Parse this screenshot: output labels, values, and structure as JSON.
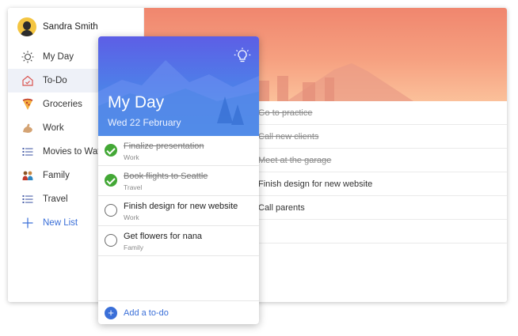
{
  "user": {
    "name": "Sandra Smith"
  },
  "sidebar": {
    "items": [
      {
        "label": "My Day",
        "icon": "sun-icon"
      },
      {
        "label": "To-Do",
        "icon": "home-icon"
      },
      {
        "label": "Groceries",
        "icon": "pizza-icon"
      },
      {
        "label": "Work",
        "icon": "flex-arm-icon"
      },
      {
        "label": "Movies to Watch",
        "icon": "list-icon"
      },
      {
        "label": "Family",
        "icon": "family-icon"
      },
      {
        "label": "Travel",
        "icon": "list-icon"
      }
    ],
    "new_list_label": "New List"
  },
  "background_tasks": [
    {
      "title": "Go to practice",
      "done": true
    },
    {
      "title": "Call new clients",
      "done": true
    },
    {
      "title": "Meet at the garage",
      "done": true
    },
    {
      "title": "Finish design for new website",
      "done": false
    },
    {
      "title": "Call parents",
      "done": false
    }
  ],
  "myday": {
    "title": "My Day",
    "date": "Wed 22 February",
    "tasks": [
      {
        "title": "Finalize presentation",
        "list": "Work",
        "done": true
      },
      {
        "title": "Book flights to Seattle",
        "list": "Travel",
        "done": true
      },
      {
        "title": "Finish design for new website",
        "list": "Work",
        "done": false
      },
      {
        "title": "Get flowers for nana",
        "list": "Family",
        "done": false
      }
    ],
    "add_label": "Add a to-do"
  },
  "colors": {
    "accent": "#3a6fd8",
    "check_done": "#43a836",
    "hero_top": "#f0866e",
    "card_head_top": "#5d5ee6"
  }
}
